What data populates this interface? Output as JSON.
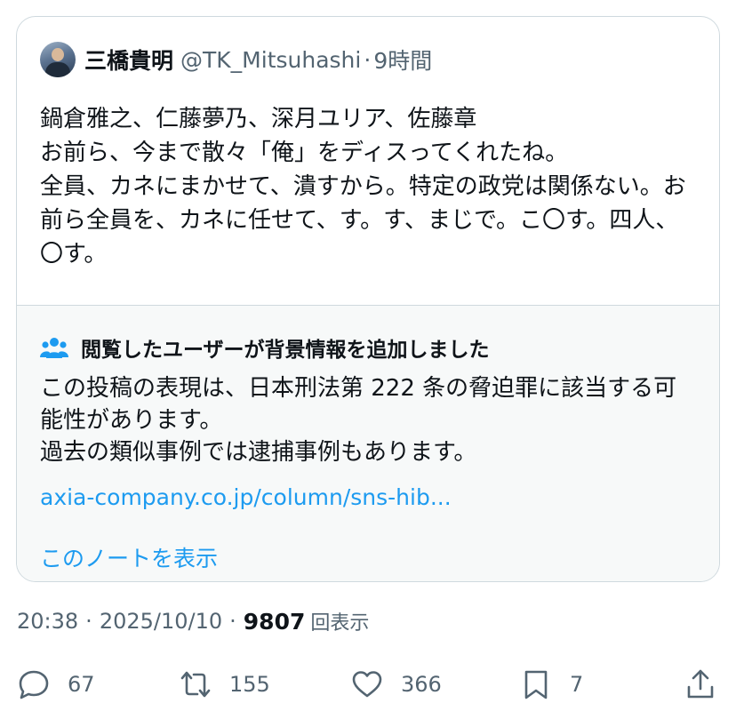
{
  "quoted_tweet": {
    "name": "三橋貴明",
    "handle": "@TK_Mitsuhashi",
    "dot": "·",
    "time": "9時間",
    "text": "鍋倉雅之、仁藤夢乃、深月ユリア、佐藤章\nお前ら、今まで散々「俺」をディスってくれたね。\n全員、カネにまかせて、潰すから。特定の政党は関係ない。お前ら全員を、カネに任せて、す。す、まじで。こ〇す。四人、〇す。"
  },
  "community_note": {
    "icon": "people-icon",
    "title": "閲覧したユーザーが背景情報を追加しました",
    "body": "この投稿の表現は、日本刑法第 222 条の脅迫罪に該当する可能性があります。\n過去の類似事例では逮捕事例もあります。",
    "link": "axia-company.co.jp/column/sns-hib...",
    "show_note": "このノートを表示"
  },
  "meta": {
    "time": "20:38",
    "sep1": "·",
    "date": "2025/10/10",
    "sep2": "·",
    "views": "9807",
    "views_label": "回表示"
  },
  "actions": {
    "reply": {
      "icon": "reply-icon",
      "count": "67"
    },
    "retweet": {
      "icon": "retweet-icon",
      "count": "155"
    },
    "like": {
      "icon": "heart-icon",
      "count": "366"
    },
    "bookmark": {
      "icon": "bookmark-icon",
      "count": "7"
    },
    "share": {
      "icon": "share-icon"
    }
  },
  "colors": {
    "text": "#0f1419",
    "secondary": "#536471",
    "link": "#1d9bf0",
    "note_bg": "#f7f9f9",
    "border": "#cfd9de"
  }
}
